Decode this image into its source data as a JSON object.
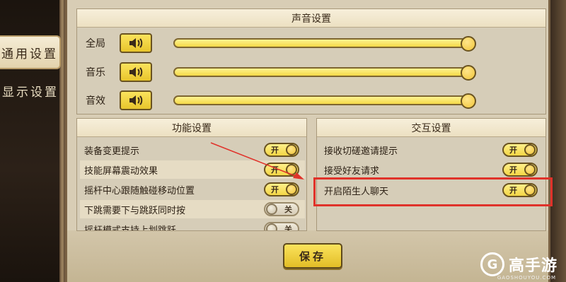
{
  "sidebar": {
    "tabs": [
      {
        "label": "通用设置",
        "active": true
      },
      {
        "label": "显示设置",
        "active": false
      }
    ]
  },
  "sound": {
    "title": "声音设置",
    "rows": [
      {
        "label": "全局",
        "icon": "speaker-icon",
        "level": 1.0
      },
      {
        "label": "音乐",
        "icon": "speaker-icon",
        "level": 1.0
      },
      {
        "label": "音效",
        "icon": "speaker-icon",
        "level": 1.0
      }
    ]
  },
  "function": {
    "title": "功能设置",
    "rows": [
      {
        "label": "装备变更提示",
        "state": "开"
      },
      {
        "label": "技能屏幕震动效果",
        "state": "开"
      },
      {
        "label": "摇杆中心跟随触碰移动位置",
        "state": "开"
      },
      {
        "label": "下跳需要下与跳跃同时按",
        "state": "关"
      },
      {
        "label": "摇杆模式支持上划跳跃",
        "state": "关"
      }
    ]
  },
  "interaction": {
    "title": "交互设置",
    "rows": [
      {
        "label": "接收切磋邀请提示",
        "state": "开"
      },
      {
        "label": "接受好友请求",
        "state": "开"
      },
      {
        "label": "开启陌生人聊天",
        "state": "开"
      }
    ]
  },
  "save_label": "保存",
  "watermark": {
    "text": "高手游",
    "sub": "GAOSHOUYOU.COM",
    "logo": "G"
  },
  "colors": {
    "accent_yellow": "#f3d646",
    "highlight_red": "#e0322a"
  }
}
